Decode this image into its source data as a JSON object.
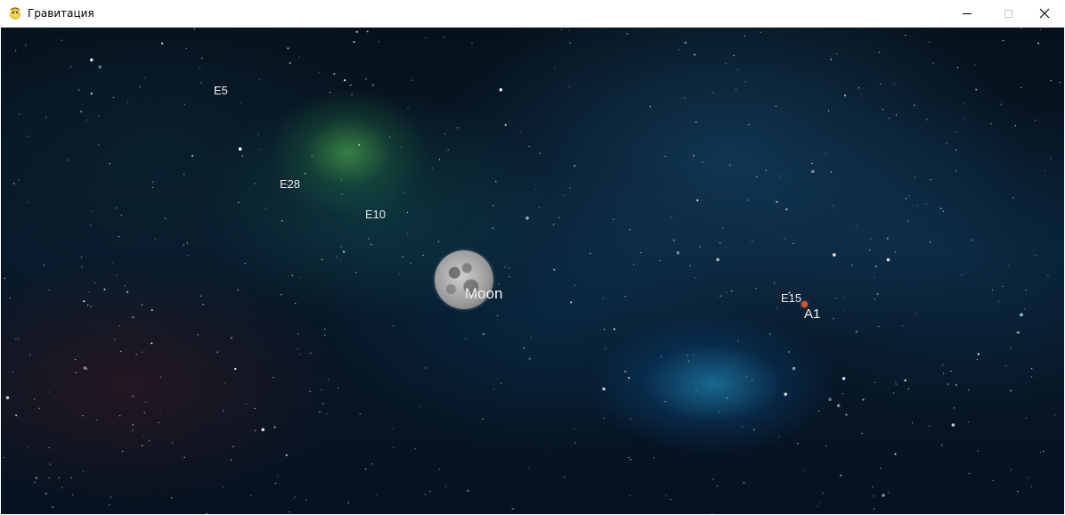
{
  "window": {
    "title": "Гравитация",
    "app_icon": "pygame-snake-icon"
  },
  "scene": {
    "moon": {
      "label": "Moon"
    },
    "bodies": [
      {
        "label": "E5"
      },
      {
        "label": "E28"
      },
      {
        "label": "E10"
      },
      {
        "label": "E15"
      },
      {
        "label": "A1",
        "color": "#d9552e"
      }
    ]
  },
  "colors": {
    "background": "#08192a",
    "label_text": "#eaeaea",
    "a1_body": "#d9552e"
  }
}
